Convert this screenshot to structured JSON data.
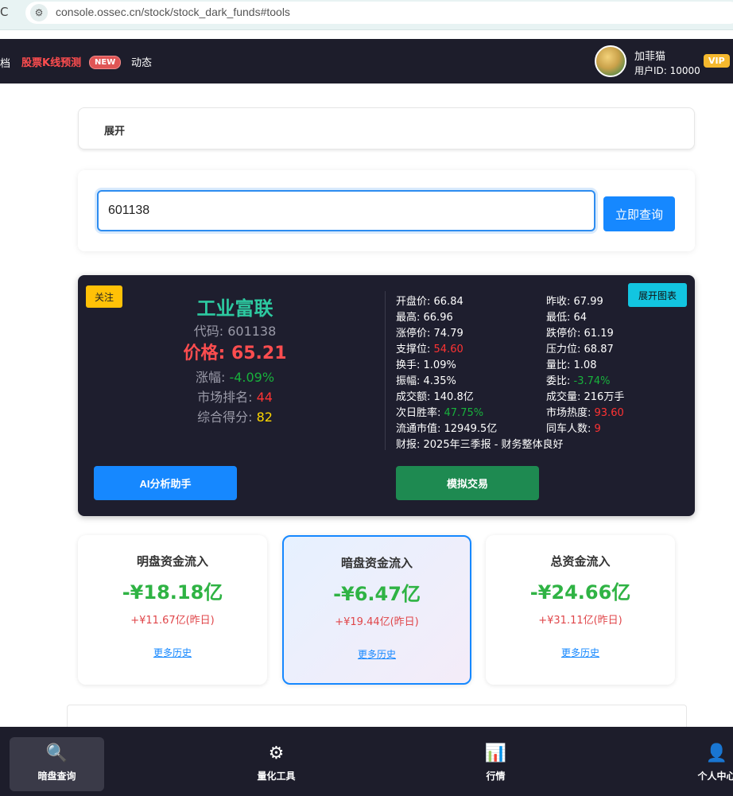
{
  "browser": {
    "url": "console.ossec.cn/stock/stock_dark_funds#tools"
  },
  "nav": {
    "fragment": "档",
    "kline": "股票K线预测",
    "new_badge": "NEW",
    "dongtai": "动态",
    "user_name": "加菲猫",
    "user_id": "用户ID: 10000",
    "vip": "VIP"
  },
  "expand": {
    "label": "展开"
  },
  "search": {
    "value": "601138",
    "button": "立即查询"
  },
  "stock": {
    "follow": "关注",
    "chart_btn": "展开图表",
    "name": "工业富联",
    "code_label": "代码: ",
    "code": "601138",
    "price_label": "价格: ",
    "price": "65.21",
    "change_label": "涨幅: ",
    "change": "-4.09%",
    "rank_label": "市场排名: ",
    "rank": "44",
    "score_label": "综合得分: ",
    "score": "82",
    "open_label": "开盘价: ",
    "open": "66.84",
    "prev_close_label": "昨收: ",
    "prev_close": "67.99",
    "high_label": "最高: ",
    "high": "66.96",
    "low_label": "最低: ",
    "low": "64",
    "limit_up_label": "涨停价: ",
    "limit_up": "74.79",
    "limit_down_label": "跌停价: ",
    "limit_down": "61.19",
    "support_label": "支撑位: ",
    "support": "54.60",
    "resistance_label": "压力位: ",
    "resistance": "68.87",
    "turnover_label": "换手: ",
    "turnover": "1.09%",
    "volume_ratio_label": "量比: ",
    "volume_ratio": "1.08",
    "amplitude_label": "振幅: ",
    "amplitude": "4.35%",
    "commission_label": "委比: ",
    "commission": "-3.74%",
    "amount_label": "成交额: ",
    "amount": "140.8亿",
    "volume_label": "成交量: ",
    "volume": "216万手",
    "win_rate_label": "次日胜率: ",
    "win_rate": "47.75%",
    "heat_label": "市场热度: ",
    "heat": "93.60",
    "market_cap_label": "流通市值: ",
    "market_cap": "12949.5亿",
    "peers_label": "同车人数: ",
    "peers": "9",
    "report": "财报: 2025年三季报 - 财务整体良好",
    "ai_btn": "AI分析助手",
    "trade_btn": "模拟交易"
  },
  "funds": [
    {
      "title": "明盘资金流入",
      "value": "-¥18.18亿",
      "prev": "+¥11.67亿(昨日)",
      "link": "更多历史"
    },
    {
      "title": "暗盘资金流入",
      "value": "-¥6.47亿",
      "prev": "+¥19.44亿(昨日)",
      "link": "更多历史"
    },
    {
      "title": "总资金流入",
      "value": "-¥24.66亿",
      "prev": "+¥31.11亿(昨日)",
      "link": "更多历史"
    }
  ],
  "tabs": [
    {
      "label": "暗盘查询",
      "icon": "🔍"
    },
    {
      "label": "量化工具",
      "icon": "⚙"
    },
    {
      "label": "行情",
      "icon": "📊"
    },
    {
      "label": "个人中心",
      "icon": "👤"
    }
  ]
}
